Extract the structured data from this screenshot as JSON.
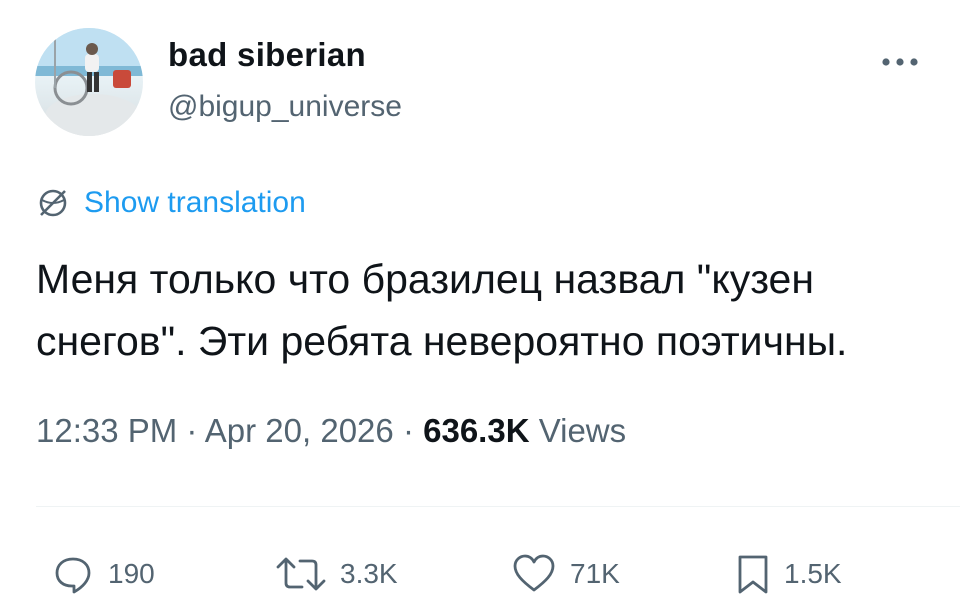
{
  "author": {
    "display_name": "bad siberian",
    "handle": "@bigup_universe"
  },
  "icons": {
    "avatar": "profile-photo",
    "more": "more-horizontal-icon",
    "translate": "globe-icon",
    "reply": "reply-icon",
    "retweet": "retweet-icon",
    "like": "heart-icon",
    "bookmark": "bookmark-icon"
  },
  "translation": {
    "label": "Show translation"
  },
  "tweet": {
    "line1": "Меня только что бразилец назвал \"кузен",
    "line2": "снегов\". Эти ребята невероятно поэтичны."
  },
  "meta": {
    "time": "12:33 PM",
    "separator": "·",
    "date": "Apr 20, 2026",
    "views_count": "636.3K",
    "views_label": "Views"
  },
  "actions": {
    "replies": "190",
    "retweets": "3.3K",
    "likes": "71K",
    "bookmarks": "1.5K"
  },
  "colors": {
    "text": "#0f1419",
    "secondary": "#536471",
    "link": "#1d9bf0",
    "divider": "#eff3f4"
  }
}
